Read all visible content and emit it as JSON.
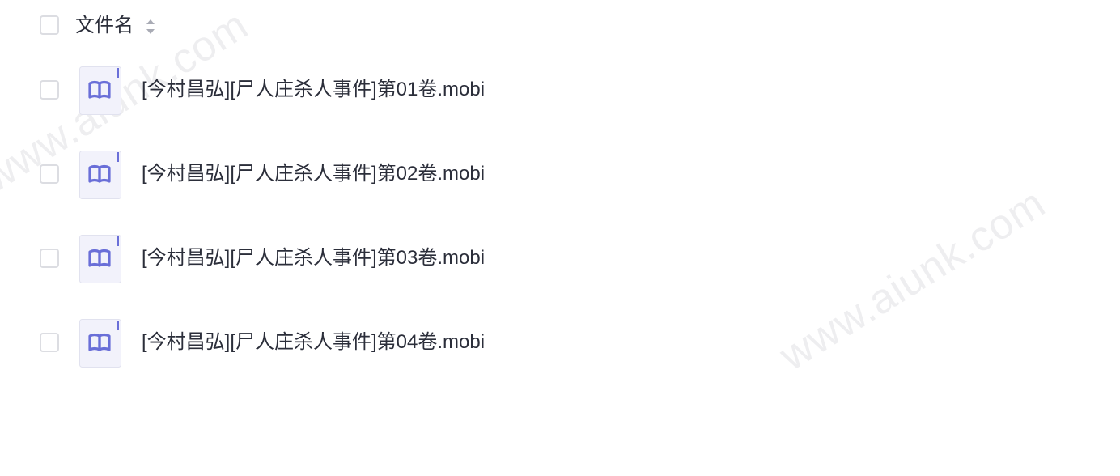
{
  "header": {
    "column_label": "文件名",
    "sort_icon": "sort-caret-icon"
  },
  "files": [
    {
      "name": "[今村昌弘][尸人庄杀人事件]第01卷.mobi",
      "icon": "book-icon"
    },
    {
      "name": "[今村昌弘][尸人庄杀人事件]第02卷.mobi",
      "icon": "book-icon"
    },
    {
      "name": "[今村昌弘][尸人庄杀人事件]第03卷.mobi",
      "icon": "book-icon"
    },
    {
      "name": "[今村昌弘][尸人庄杀人事件]第04卷.mobi",
      "icon": "book-icon"
    }
  ],
  "watermark": "www.aiunk.com",
  "colors": {
    "icon_accent": "#6a6fd8",
    "icon_bg": "#f2f2fb",
    "checkbox_border": "#dcdde2",
    "text": "#2b2e3a"
  }
}
